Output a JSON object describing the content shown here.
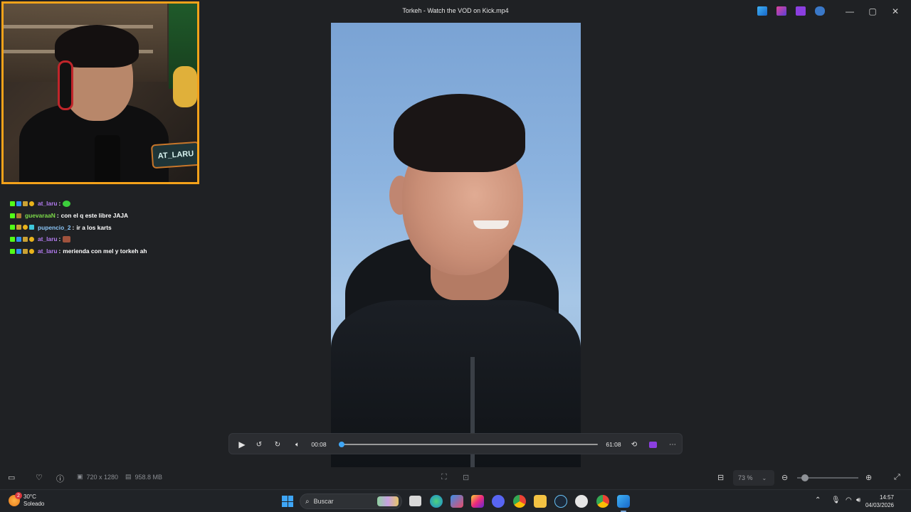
{
  "window": {
    "title": "Torkeh - Watch the VOD on Kick.mp4"
  },
  "webcam_overlay": {
    "badge_text": "AT_LARU"
  },
  "chat": {
    "messages": [
      {
        "user": "at_laru",
        "user_color": "#b47cf2",
        "text": "",
        "emote": "green-emote"
      },
      {
        "user": "guevaraaN",
        "user_color": "#7ddc4a",
        "text": "con el q este libre JAJA",
        "emote": ""
      },
      {
        "user": "pupencio_2",
        "user_color": "#8ac4f5",
        "text": "ir a los karts",
        "emote": ""
      },
      {
        "user": "at_laru",
        "user_color": "#b47cf2",
        "text": "",
        "emote": "brown-emote"
      },
      {
        "user": "at_laru",
        "user_color": "#b47cf2",
        "text": "merienda con mel y torkeh ah",
        "emote": ""
      }
    ]
  },
  "player": {
    "current_time": "00:08",
    "total_time": "61:08",
    "progress": 0.01
  },
  "statusbar": {
    "resolution": "720 x 1280",
    "file_size": "958.8 MB",
    "zoom": "73 %"
  },
  "taskbar": {
    "weather_temp": "30°C",
    "weather_desc": "Soleado",
    "weather_alert": "2",
    "search_placeholder": "Buscar",
    "time": "14:57",
    "date": "04/03/2026"
  },
  "colors": {
    "accent": "#3fa6f5",
    "webcam_border": "#f4a21a"
  }
}
